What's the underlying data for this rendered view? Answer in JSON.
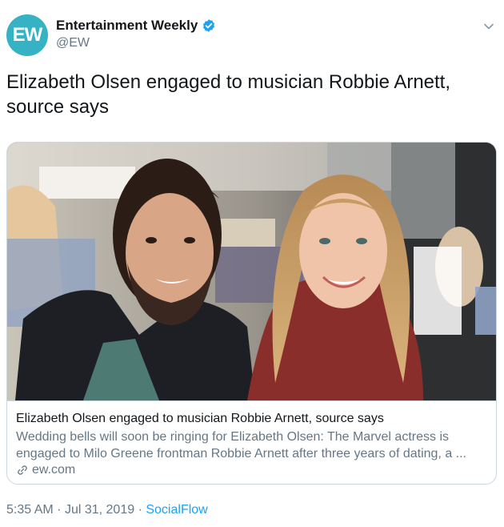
{
  "author": {
    "avatar_text": "EW",
    "display_name": "Entertainment Weekly",
    "handle": "@EW",
    "verified": true,
    "avatar_color": "#35b3c4"
  },
  "tweet": {
    "text": "Elizabeth Olsen engaged to musician Robbie Arnett, source says"
  },
  "card": {
    "title": "Elizabeth Olsen engaged to musician Robbie Arnett, source says",
    "description": "Wedding bells will soon be ringing for Elizabeth Olsen: The Marvel actress is engaged to Milo Greene frontman Robbie Arnett after three years of dating, a ...",
    "domain": "ew.com"
  },
  "meta": {
    "time": "5:35 AM",
    "separator": "·",
    "date": "Jul 31, 2019",
    "source": "SocialFlow"
  },
  "colors": {
    "link_blue": "#1da1f2",
    "muted_gray": "#657786",
    "verified_blue": "#1da1f2"
  },
  "icons": {
    "verified": "verified-badge-icon",
    "menu": "chevron-down-icon",
    "link": "link-icon"
  }
}
